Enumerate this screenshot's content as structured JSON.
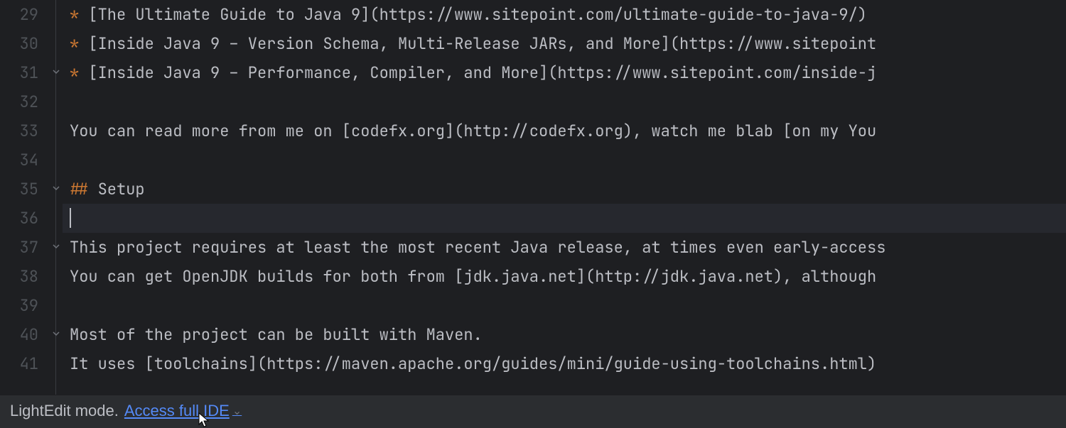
{
  "editor": {
    "lines": [
      {
        "num": 29,
        "segments": [
          {
            "cls": "orange",
            "t": "* "
          },
          {
            "cls": "plain",
            "t": "[The Ultimate Guide to Java 9](https://www.sitepoint.com/ultimate-guide-to-java-9/)"
          }
        ]
      },
      {
        "num": 30,
        "segments": [
          {
            "cls": "orange",
            "t": "* "
          },
          {
            "cls": "plain",
            "t": "[Inside Java 9 – Version Schema, Multi-Release JARs, and More](https://www.sitepoint"
          }
        ]
      },
      {
        "num": 31,
        "segments": [
          {
            "cls": "orange",
            "t": "* "
          },
          {
            "cls": "plain",
            "t": "[Inside Java 9 – Performance, Compiler, and More](https://www.sitepoint.com/inside-j"
          }
        ],
        "foldOpen": true
      },
      {
        "num": 32,
        "segments": []
      },
      {
        "num": 33,
        "segments": [
          {
            "cls": "plain",
            "t": "You can read more from me on [codefx.org](http://codefx.org), watch me blab [on my You"
          }
        ]
      },
      {
        "num": 34,
        "segments": []
      },
      {
        "num": 35,
        "segments": [
          {
            "cls": "orange",
            "t": "## "
          },
          {
            "cls": "plain",
            "t": "Setup"
          }
        ],
        "foldOpen": true
      },
      {
        "num": 36,
        "segments": [],
        "current": true,
        "caret": true
      },
      {
        "num": 37,
        "segments": [
          {
            "cls": "plain",
            "t": "This project requires at least the most recent Java release, at times even early-access"
          }
        ],
        "foldOpen": true
      },
      {
        "num": 38,
        "segments": [
          {
            "cls": "plain",
            "t": "You can get OpenJDK builds for both from [jdk.java.net](http://jdk.java.net), although"
          }
        ]
      },
      {
        "num": 39,
        "segments": []
      },
      {
        "num": 40,
        "segments": [
          {
            "cls": "plain",
            "t": "Most of the project can be built with Maven."
          }
        ],
        "foldOpen": true
      },
      {
        "num": 41,
        "segments": [
          {
            "cls": "plain",
            "t": "It uses [toolchains](https://maven.apache.org/guides/mini/guide-using-toolchains.html)"
          }
        ]
      }
    ]
  },
  "statusbar": {
    "mode_label": "LightEdit mode.",
    "link_label": "Access full IDE"
  }
}
